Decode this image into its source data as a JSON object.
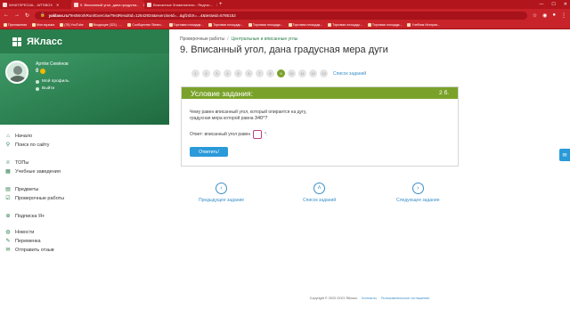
{
  "browser": {
    "tabs": [
      {
        "label": "WHATSPECIAL...WTSBOX",
        "active": false
      },
      {
        "label": "9. Вписанный угол, дана градусна...",
        "active": true
      },
      {
        "label": "Вписанные Знаменатели - Яндекс...",
        "active": false
      }
    ],
    "url_host": "yaklass.ru",
    "url_path": "/TestWorkRun/Exercise/TestResultId=12642934&exerciseId=...&gfzsbX=...4&testwid=5785152",
    "bookmarks": [
      "Приложения",
      "Моя музыка",
      "(78) YouTube",
      "Входящие (321) - ...",
      "Сообщество Steam...",
      "Торговая площадк...",
      "Торговая площадк...",
      "Торговая площадк...",
      "Торговая площадк...",
      "Торговая площадк...",
      "Торговая площадк...",
      "Учебник Истории..."
    ]
  },
  "sidebar": {
    "logo": "ЯКласс",
    "profile": {
      "name": "Артём Семёнов",
      "coins": "0",
      "my_profile": "Мой профиль",
      "logout": "Выйти"
    },
    "items": [
      {
        "label": "Начало",
        "icon": "home-icon"
      },
      {
        "label": "Поиск по сайту",
        "icon": "search-icon"
      },
      {
        "label": "ТОПы",
        "icon": "cup-icon"
      },
      {
        "label": "Учебные заведения",
        "icon": "building-icon"
      },
      {
        "label": "Предметы",
        "icon": "book-icon"
      },
      {
        "label": "Проверочные работы",
        "icon": "checklist-icon"
      },
      {
        "label": "Подписка Я+",
        "icon": "plus-icon"
      },
      {
        "label": "Новости",
        "icon": "news-icon"
      },
      {
        "label": "Переменка",
        "icon": "pen-icon"
      },
      {
        "label": "Отправить отзыв",
        "icon": "feedback-icon"
      }
    ]
  },
  "main": {
    "breadcrumb": {
      "first": "Проверочные работы",
      "sep": "/",
      "second": "Центральные и вписанные углы"
    },
    "title": "9. Вписанный угол, дана градусная мера дуги",
    "pager": {
      "pages": [
        "1",
        "2",
        "3",
        "4",
        "5",
        "6",
        "7",
        "8",
        "9",
        "10",
        "11",
        "12",
        "13"
      ],
      "current": 9,
      "list_link": "Список заданий"
    },
    "task": {
      "header": "Условие задания:",
      "score": "2 б.",
      "question_line1": "Чему равен вписанный угол, который опирается на дугу,",
      "question_line2": "градусная мера которой равна",
      "degree_value": "340°?",
      "answer_prefix": "Ответ: вписанный угол равен",
      "answer_value": "",
      "answer_suffix": "°.",
      "submit": "Ответить!"
    },
    "nav": {
      "prev": "Предыдущее задание",
      "list": "Список заданий",
      "next": "Следующее задание"
    },
    "footer": {
      "copyright": "Copyright © 2020 ООО ЯКласс",
      "contacts": "Контакты",
      "agreement": "Пользовательское соглашение"
    }
  }
}
